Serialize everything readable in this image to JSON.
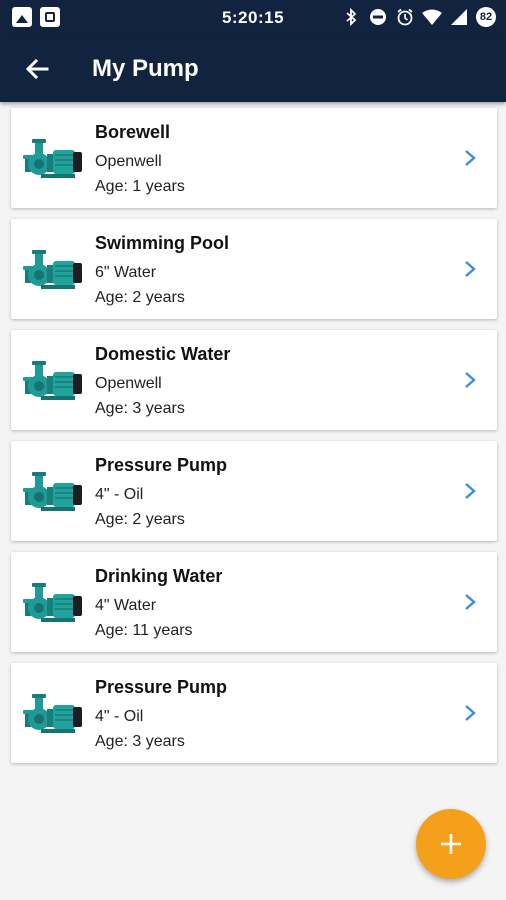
{
  "status_bar": {
    "time": "5:20:15",
    "left_icons": [
      "image-notification-icon",
      "app-notification-icon"
    ],
    "right_icons": [
      "bluetooth-icon",
      "do-not-disturb-icon",
      "alarm-icon",
      "wifi-icon",
      "signal-icon",
      "battery-icon"
    ],
    "battery_level": "82"
  },
  "app_bar": {
    "title": "My Pump",
    "back_icon": "arrow-left-icon"
  },
  "pumps": [
    {
      "name": "Borewell",
      "type": "Openwell",
      "age": "Age:  1 years"
    },
    {
      "name": "Swimming Pool",
      "type": "6\" Water",
      "age": "Age:  2 years"
    },
    {
      "name": "Domestic Water",
      "type": "Openwell",
      "age": "Age:  3 years"
    },
    {
      "name": "Pressure Pump",
      "type": "4\" - Oil",
      "age": "Age:  2 years"
    },
    {
      "name": "Drinking Water",
      "type": "4\" Water",
      "age": "Age:  11 years"
    },
    {
      "name": "Pressure Pump",
      "type": "4\" - Oil",
      "age": "Age:  3 years"
    }
  ],
  "fab": {
    "icon": "plus-icon"
  },
  "colors": {
    "app_bar": "#12233f",
    "accent_chevron": "#3b8de0",
    "fab": "#f5a01a",
    "pump_teal": "#1f9a96"
  }
}
